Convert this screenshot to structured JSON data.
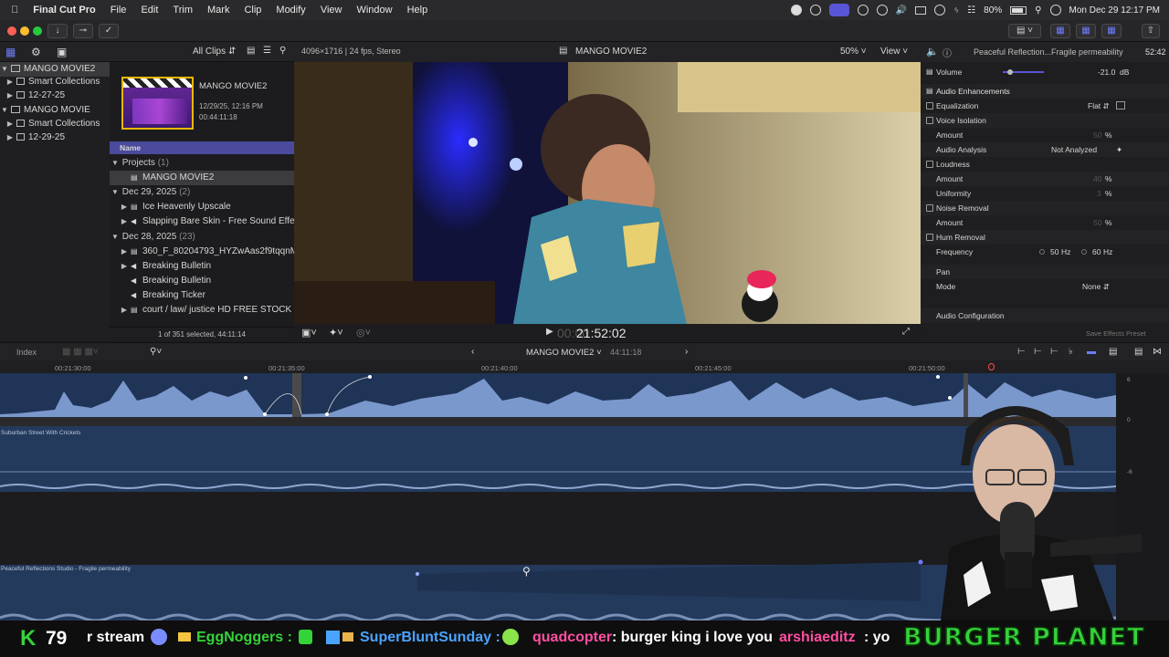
{
  "menubar": {
    "app": "Final Cut Pro",
    "menus": [
      "File",
      "Edit",
      "Trim",
      "Mark",
      "Clip",
      "Modify",
      "View",
      "Window",
      "Help"
    ],
    "battery": "80%",
    "datetime": "Mon Dec 29  12:17 PM"
  },
  "browser": {
    "filter": "All Clips",
    "clip_name": "MANGO MOVIE2",
    "clip_date": "12/29/25, 12:16 PM",
    "clip_duration": "00:44:11:18",
    "column_name": "Name",
    "status": "1 of 351 selected, 44:11:14",
    "groups": [
      {
        "label": "Projects",
        "count": "(1)"
      },
      {
        "label": "Dec 29, 2025",
        "count": "(2)"
      },
      {
        "label": "Dec 28, 2025",
        "count": "(23)"
      }
    ],
    "items": [
      "MANGO MOVIE2",
      "Ice Heavenly Upscale",
      "Slapping Bare Skin - Free Sound Effects",
      "360_F_80204793_HYZwAas2f9tqqnMNj",
      "Breaking Bulletin",
      "Breaking Bulletin",
      "Breaking Ticker",
      "court / law/ justice HD FREE STOCK FOOTAGE"
    ]
  },
  "sidebar": {
    "libraries": [
      {
        "name": "MANGO MOVIE2",
        "children": [
          "Smart Collections",
          "12-27-25"
        ]
      },
      {
        "name": "MANGO MOVIE",
        "children": [
          "Smart Collections",
          "12-29-25"
        ]
      }
    ]
  },
  "viewer": {
    "format": "4096×1716 | 24 fps, Stereo",
    "title": "MANGO MOVIE2",
    "zoom": "50%",
    "view_label": "View",
    "timecode_prefix": "00:00",
    "timecode": "21:52:02"
  },
  "inspector": {
    "title": "Peaceful Reflection...Fragile permeability",
    "duration": "52:42",
    "volume_label": "Volume",
    "volume_value": "-21.0",
    "volume_unit": "dB",
    "section": "Audio Enhancements",
    "rows": [
      {
        "label": "Equalization",
        "value": "Flat"
      },
      {
        "label": "Voice Isolation",
        "value": ""
      },
      {
        "label": "Amount",
        "value": "50",
        "unit": "%"
      },
      {
        "label": "Audio Analysis",
        "value": "Not Analyzed"
      },
      {
        "label": "Loudness",
        "value": ""
      },
      {
        "label": "Amount",
        "value": "40",
        "unit": "%"
      },
      {
        "label": "Uniformity",
        "value": "3",
        "unit": "%"
      },
      {
        "label": "Noise Removal",
        "value": ""
      },
      {
        "label": "Amount",
        "value": "50",
        "unit": "%"
      },
      {
        "label": "Hum Removal",
        "value": ""
      }
    ],
    "frequency_label": "Frequency",
    "freq_a": "50",
    "freq_b": "60",
    "freq_unit": "Hz",
    "pan_label": "Pan",
    "mode_label": "Mode",
    "mode_value": "None",
    "audio_config": "Audio Configuration",
    "save_preset": "Save Effects Preset"
  },
  "timeline": {
    "index_label": "Index",
    "project": "MANGO MOVIE2",
    "duration": "44:11:18",
    "ruler": [
      "00:21:30:00",
      "00:21:35:00",
      "00:21:40:00",
      "00:21:45:00",
      "00:21:50:00"
    ],
    "clip2": "Suburban Street With Crickets",
    "clip3": "Peaceful Reflections Studio - Fragile permeability",
    "meter_marks": [
      "6",
      "0",
      "-6"
    ]
  },
  "chat": {
    "count": "79",
    "segments": [
      {
        "user": "",
        "msg": "r stream"
      },
      {
        "user": "EggNoggers",
        "msg": ""
      },
      {
        "user": "SuperBluntSunday",
        "msg": ""
      },
      {
        "user": "quadcopter",
        "msg": "burger king i love you"
      },
      {
        "user": "arshiaeditz",
        "msg": "yo"
      }
    ],
    "brand": "BURGER PLANET"
  },
  "colors": {
    "accent": "#5856d6",
    "waveform": "#6d8cc0",
    "audio_clip": "#243a5c",
    "chat_green": "#35d33a",
    "chat_pink": "#ff4fa3"
  }
}
